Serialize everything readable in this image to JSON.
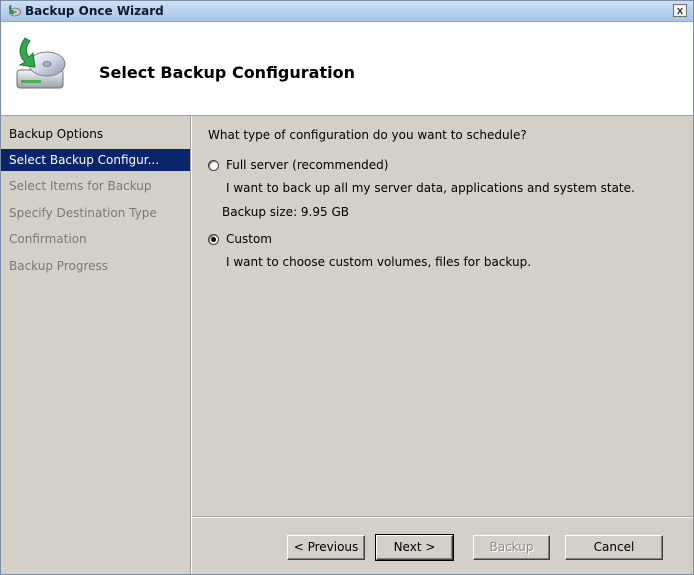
{
  "window": {
    "title": "Backup Once Wizard",
    "close_label": "x"
  },
  "header": {
    "title": "Select Backup Configuration"
  },
  "sidebar": {
    "steps": [
      {
        "label": "Backup Options",
        "state": "done"
      },
      {
        "label": "Select Backup Configur...",
        "state": "current"
      },
      {
        "label": "Select Items for Backup",
        "state": "pending"
      },
      {
        "label": "Specify Destination Type",
        "state": "pending"
      },
      {
        "label": "Confirmation",
        "state": "pending"
      },
      {
        "label": "Backup Progress",
        "state": "pending"
      }
    ]
  },
  "main": {
    "question": "What type of configuration do you want to schedule?",
    "options": [
      {
        "label": "Full server (recommended)",
        "description": "I want to back up all my server data, applications and system state.",
        "extra": "Backup size: 9.95 GB",
        "selected": false
      },
      {
        "label": "Custom",
        "description": "I want to choose custom volumes, files for backup.",
        "selected": true
      }
    ]
  },
  "buttons": {
    "previous": "< Previous",
    "next": "Next >",
    "backup": "Backup",
    "cancel": "Cancel"
  },
  "colors": {
    "selection": "#0a246a",
    "panel": "#d4d0c8",
    "disabled_text": "#7a7a7a"
  },
  "icons": {
    "app": "backup-wizard-icon",
    "header": "disk-backup-icon"
  }
}
